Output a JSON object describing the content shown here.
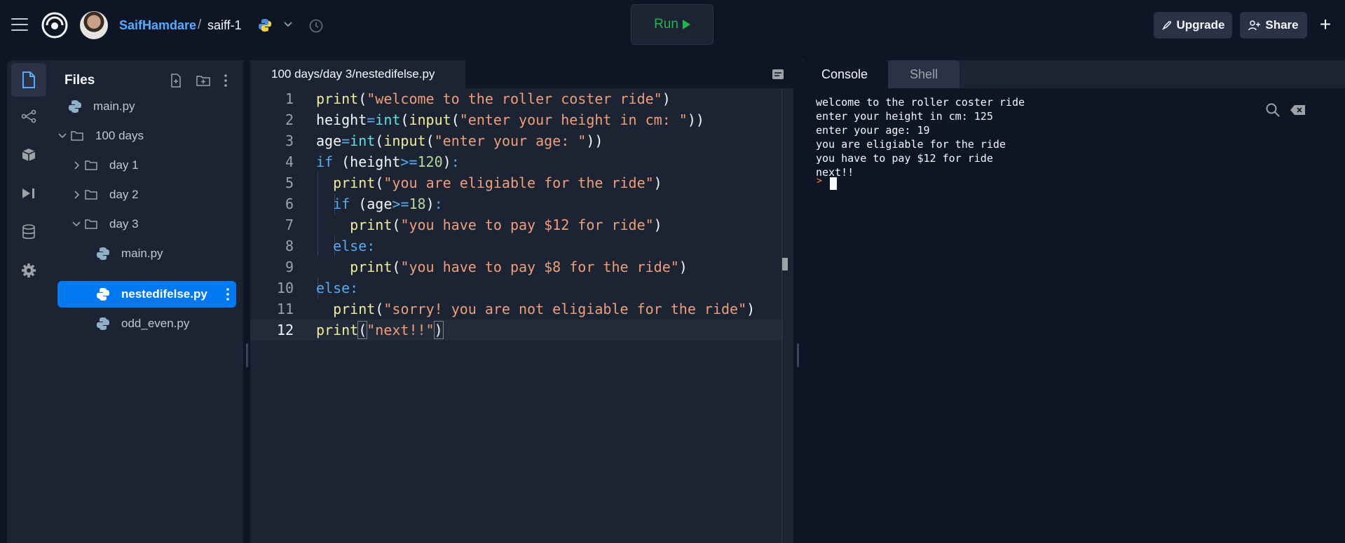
{
  "topbar": {
    "user": "SaifHamdare",
    "separator": "/",
    "repl_name": "saiff-1",
    "run_label": "Run",
    "upgrade_label": "Upgrade",
    "share_label": "Share",
    "new_label": "+"
  },
  "files": {
    "title": "Files",
    "tree": [
      {
        "label": "main.py",
        "type": "python"
      },
      {
        "label": "100 days",
        "type": "folder",
        "expanded": true
      },
      {
        "label": "day 1",
        "type": "folder",
        "expanded": false
      },
      {
        "label": "day 2",
        "type": "folder",
        "expanded": false
      },
      {
        "label": "day 3",
        "type": "folder",
        "expanded": true
      },
      {
        "label": "main.py",
        "type": "python"
      },
      {
        "label": "nestedifelse.py",
        "type": "python",
        "selected": true
      },
      {
        "label": "odd_even.py",
        "type": "python"
      }
    ]
  },
  "editor": {
    "tab_label": "100 days/day 3/nestedifelse.py",
    "line_numbers": [
      "1",
      "2",
      "3",
      "4",
      "5",
      "6",
      "7",
      "8",
      "9",
      "10",
      "11",
      "12"
    ],
    "current_line": 12
  },
  "console": {
    "tabs": [
      "Console",
      "Shell"
    ],
    "active_tab": "Console",
    "output": [
      "welcome to the roller coster ride",
      "enter your height in cm: 125",
      "enter your age: 19",
      "you are eligiable for the ride",
      "you have to pay $12 for ride",
      "next!!"
    ],
    "prompt_symbol": ">"
  },
  "colors": {
    "run_green": "#22b34a",
    "selected_blue": "#0079f2",
    "user_link": "#57abff"
  }
}
